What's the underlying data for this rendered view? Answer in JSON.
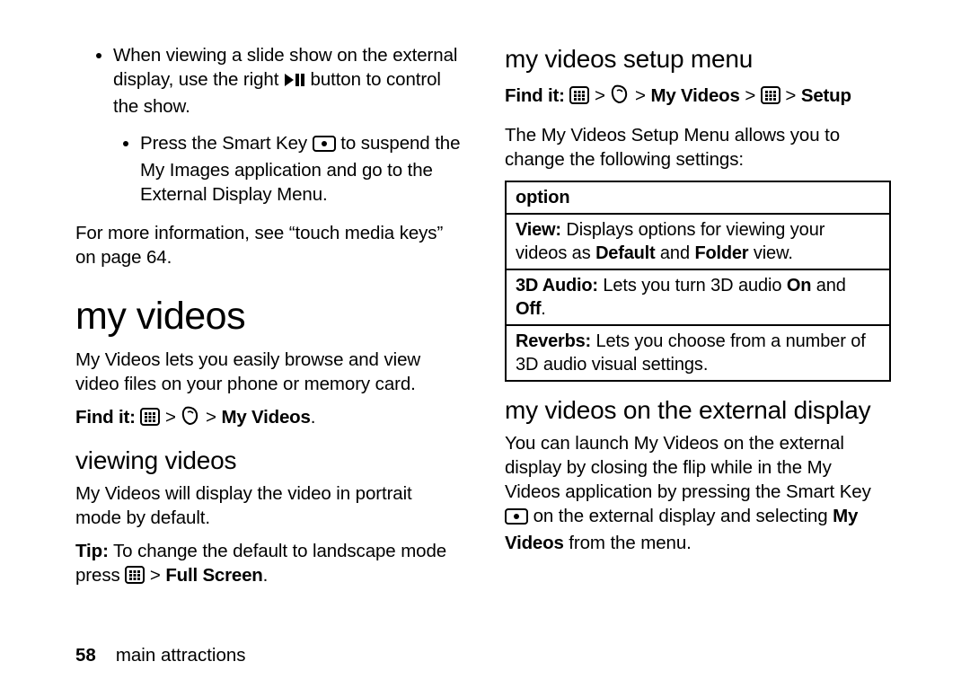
{
  "footer": {
    "page_number": "58",
    "section": "main attractions"
  },
  "left": {
    "bullet1_a": "When viewing a slide show on the external display, use the right ",
    "bullet1_b": " button to control the show.",
    "bullet2_a": "Press the Smart Key ",
    "bullet2_b": " to suspend the My Images application and go to the External Display Menu.",
    "more_info": "For more information, see “touch media keys” on page 64.",
    "h1": "my videos",
    "intro": "My Videos lets you easily browse and view video files on your phone or memory card.",
    "findit_label": "Find it:",
    "findit_sep": " > ",
    "findit_target": "My Videos",
    "h2": "viewing videos",
    "viewing_p": "My Videos will display the video in portrait mode by default.",
    "tip_label": "Tip:",
    "tip_text_a": " To change the default to landscape mode press ",
    "tip_sep": " > ",
    "tip_target": "Full Screen",
    "period": "."
  },
  "right": {
    "h2_setup": "my videos setup menu",
    "findit_label": "Find it:",
    "findit_sep": " > ",
    "findit_myvideos": "My Videos",
    "findit_setup": "Setup",
    "setup_intro": "The My Videos Setup Menu allows you to change the following settings:",
    "table_header": "option",
    "row_view_label": "View:",
    "row_view_a": " Displays options for viewing your videos as ",
    "row_view_default": "Default",
    "row_view_and": " and ",
    "row_view_folder": "Folder",
    "row_view_end": " view.",
    "row_3d_label": "3D Audio:",
    "row_3d_a": " Lets you turn 3D audio ",
    "row_3d_on": "On",
    "row_3d_and": " and ",
    "row_3d_off": "Off",
    "row_reverbs_label": "Reverbs:",
    "row_reverbs_text": " Lets you choose from a number of 3D audio visual settings.",
    "h2_ext": "my videos on the external display",
    "ext_a": "You can launch My Videos on the external display by closing the flip while in the My Videos application by pressing the Smart Key ",
    "ext_b": " on the external display and selecting ",
    "ext_myvideos": "My Videos",
    "ext_c": " from the menu.",
    "period": "."
  },
  "icons": {
    "play_pause": "play-pause-icon",
    "smart_key": "smart-key-icon",
    "menu": "menu-grid-icon",
    "multimedia": "multimedia-icon"
  }
}
